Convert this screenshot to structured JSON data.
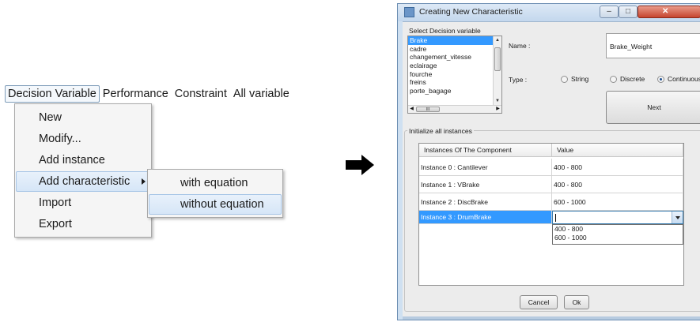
{
  "menubar": {
    "items": [
      "Decision Variable",
      "Performance",
      "Constraint",
      "All variable"
    ]
  },
  "menu": {
    "items": [
      "New",
      "Modify...",
      "Add instance",
      "Add characteristic",
      "Import",
      "Export"
    ]
  },
  "submenu": {
    "items": [
      "with equation",
      "without equation"
    ]
  },
  "dialog": {
    "title": "Creating New Characteristic",
    "select_label": "Select Decision variable",
    "variables": [
      "Brake",
      "cadre",
      "changement_vitesse",
      "eclairage",
      "fourche",
      "freins",
      "porte_bagage"
    ],
    "name_label": "Name :",
    "name_value": "Brake_Weight",
    "type_label": "Type :",
    "types": [
      {
        "label": "String",
        "selected": false
      },
      {
        "label": "Discrete",
        "selected": false
      },
      {
        "label": "Continuous",
        "selected": true
      }
    ],
    "next_label": "Next",
    "group_label": "Initialize all instances",
    "table": {
      "headers": [
        "Instances Of The Component",
        "Value"
      ],
      "rows": [
        [
          "Instance 0 : Cantilever",
          "400 - 800"
        ],
        [
          "Instance 1 : VBrake",
          "400 - 800"
        ],
        [
          "Instance 2 : DiscBrake",
          "600 - 1000"
        ],
        [
          "Instance 3 : DrumBrake",
          ""
        ]
      ],
      "dropdown_options": [
        "400 - 800",
        "600 - 1000"
      ]
    },
    "cancel_label": "Cancel",
    "ok_label": "Ok",
    "hscroll_thumb": "III"
  }
}
